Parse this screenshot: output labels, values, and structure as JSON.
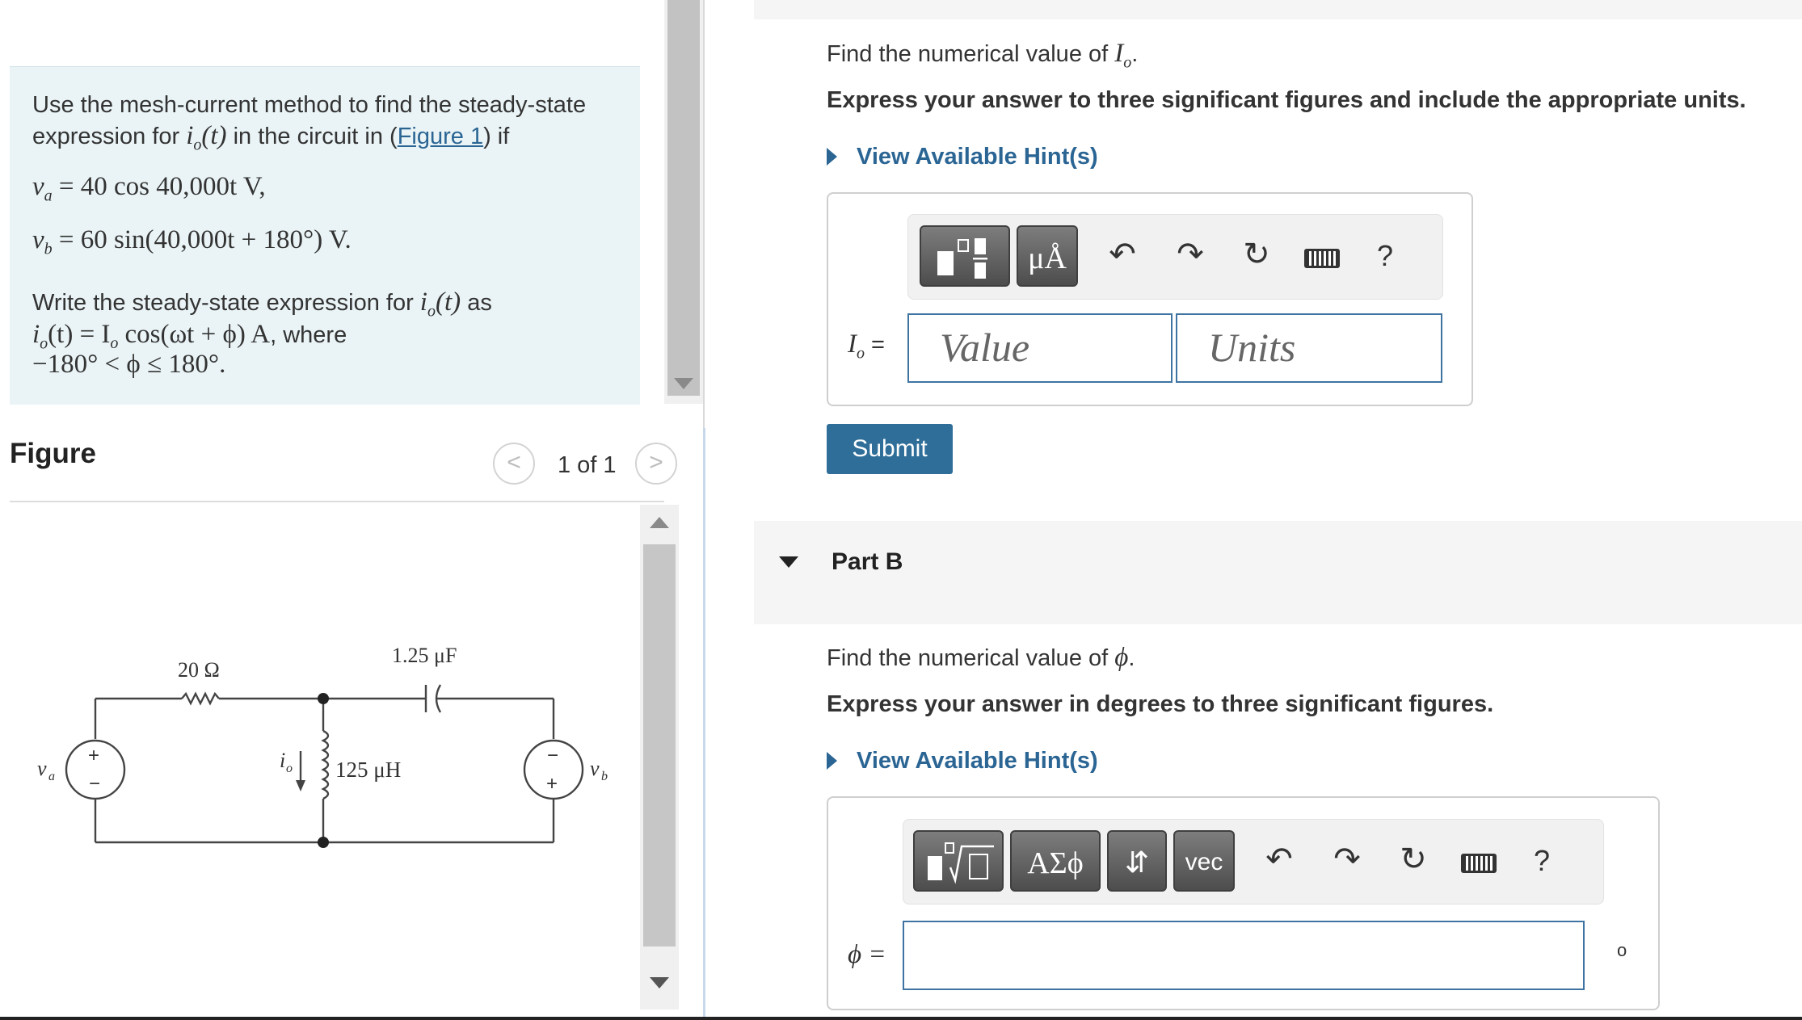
{
  "problem": {
    "line1": "Use the mesh-current method to find the steady-state",
    "line2_pre": "expression for",
    "line2_mid": "in the circuit in (",
    "figure_link": "Figure 1",
    "line2_post": ") if",
    "va_eq": "= 40 cos 40,000t V,",
    "vb_eq": "= 60 sin(40,000t + 180°) V.",
    "write_pre": "Write the steady-state expression for",
    "write_mid": "as",
    "io_expr": "(t) = I",
    "io_expr2": "cos(ωt + ϕ) A",
    "where": ", where",
    "range": "−180° < ϕ ≤ 180°."
  },
  "figure": {
    "title": "Figure",
    "pager": "1 of 1",
    "prev_glyph": "<",
    "next_glyph": ">",
    "labels": {
      "r": "20 Ω",
      "c": "1.25 μF",
      "l": "125 μH",
      "va": "v",
      "va_sub": "a",
      "vb": "v",
      "vb_sub": "b",
      "io": "i",
      "io_sub": "o",
      "plus": "+",
      "minus": "−"
    }
  },
  "part_a": {
    "prompt_pre": "Find the numerical value of",
    "var": "I",
    "var_sub": "o",
    "prompt_post": ".",
    "instruction": "Express your answer to three significant figures and include the appropriate units.",
    "hint": "View Available Hint(s)",
    "toolbar": {
      "units_btn": "μÅ",
      "help": "?"
    },
    "label_eq": " =",
    "value_placeholder": "Value",
    "units_placeholder": "Units",
    "submit": "Submit"
  },
  "part_b": {
    "header": "Part B",
    "prompt_pre": "Find the numerical value of",
    "var": "ϕ",
    "prompt_post": ".",
    "instruction": "Express your answer in degrees to three significant figures.",
    "hint": "View Available Hint(s)",
    "toolbar": {
      "greek_btn": "ΑΣϕ",
      "updown_btn": "⇵",
      "vec_btn": "vec",
      "help": "?"
    },
    "label": "ϕ =",
    "degree": "o"
  },
  "colors": {
    "accent": "#2e6e99",
    "link": "#2b6594",
    "problem_bg": "#eaf4f6"
  }
}
